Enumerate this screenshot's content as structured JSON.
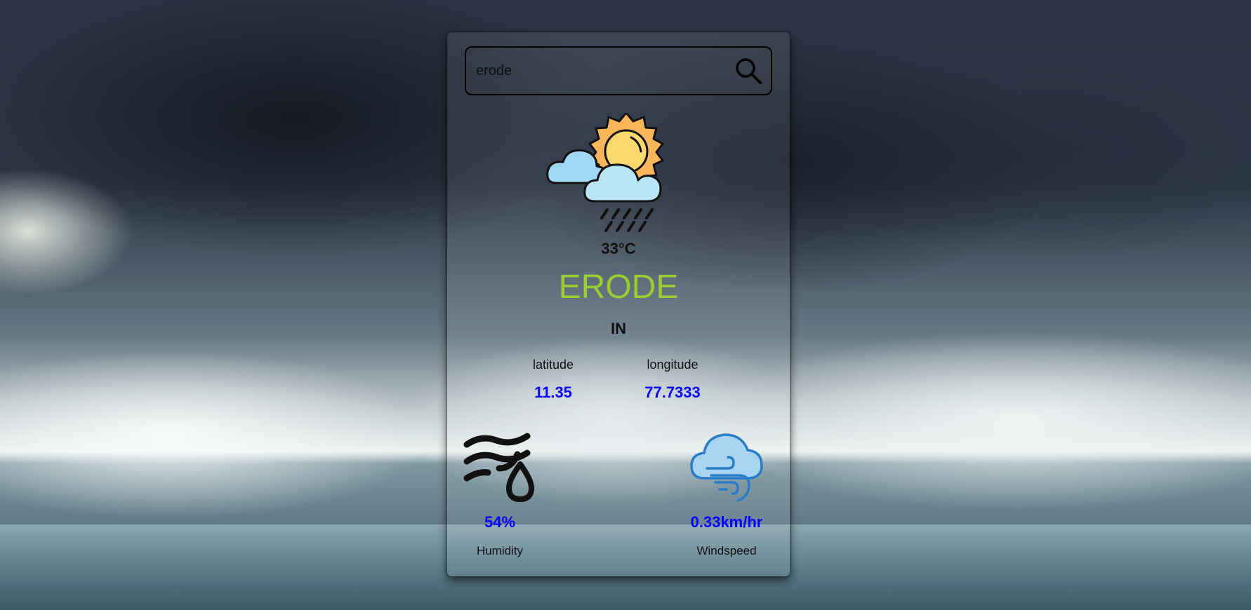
{
  "search": {
    "value": "erode",
    "placeholder": ""
  },
  "weather": {
    "icon": "sun-cloud-rain-icon",
    "temperature": "33°C",
    "city": "ERODE",
    "country": "IN"
  },
  "coordinates": {
    "latitude_label": "latitude",
    "latitude_value": "11.35",
    "longitude_label": "longitude",
    "longitude_value": "77.7333"
  },
  "stats": {
    "humidity_value": "54%",
    "humidity_label": "Humidity",
    "humidity_icon": "humidity-icon",
    "windspeed_value": "0.33km/hr",
    "windspeed_label": "Windspeed",
    "windspeed_icon": "wind-cloud-icon"
  },
  "colors": {
    "city": "#9acd32",
    "value": "#0a00ff",
    "text": "#111111"
  }
}
